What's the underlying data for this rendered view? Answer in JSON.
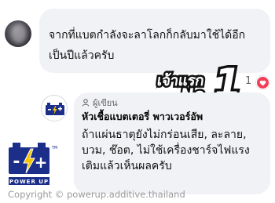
{
  "comment": {
    "text_line1": "จากที่แบตกำลังจะลาโลกก็กลับมาใช้ได้อีก",
    "text_line2": "เป็นปีแล้วครับ",
    "reaction_count": "1"
  },
  "badge": {
    "text": "เจ้าแรก",
    "no": "No.",
    "number": "1"
  },
  "reply": {
    "role_label": "ผู้เขียน",
    "author": "หัวเชื้อแบตเตอรี่ พาวเวอร์อัพ",
    "lines": [
      "ถ้าแผ่นธาตุยังไม่กร่อนเสีย, ละลาย,",
      "บวม, ช๊อต, ไม่ใช้เครื่องชาร์จไฟแรง",
      "เติมแล้วเห็นผลครับ"
    ]
  },
  "logo": {
    "minus": "-",
    "plus": "+",
    "tm": "TM",
    "brand": "POWER UP"
  },
  "copyright": "Copyright © powerup.additive.thailand",
  "colors": {
    "bubble": "#f0f2f5",
    "heart": "#f33e58",
    "logo_blue": "#1b2f8a",
    "bolt": "#f5c400"
  }
}
